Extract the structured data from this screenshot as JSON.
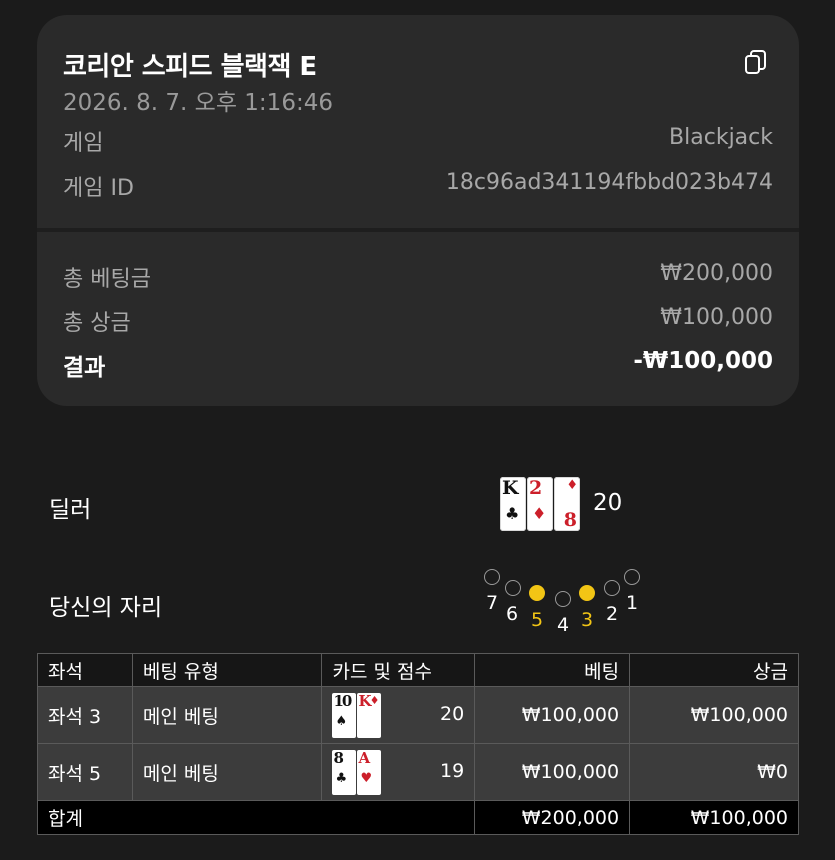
{
  "summary": {
    "title": "코리안 스피드 블랙잭 E",
    "datetime": "2026. 8. 7. 오후 1:16:46",
    "game_label": "게임",
    "game_value": "Blackjack",
    "game_id_label": "게임 ID",
    "game_id_value": "18c96ad341194fbbd023b474",
    "total_bet_label": "총 베팅금",
    "total_bet_value": "₩200,000",
    "total_win_label": "총 상금",
    "total_win_value": "₩100,000",
    "result_label": "결과",
    "result_value": "-₩100,000"
  },
  "dealer": {
    "label": "딜러",
    "score": "20",
    "cards": [
      {
        "rank": "K",
        "suit": "♣",
        "color": "black"
      },
      {
        "rank": "2",
        "suit": "♦",
        "color": "red"
      },
      {
        "rank": "8",
        "suit": "♦",
        "color": "red"
      }
    ]
  },
  "seats": {
    "label": "당신의 자리",
    "numbers": [
      "7",
      "6",
      "5",
      "4",
      "3",
      "2",
      "1"
    ],
    "active": [
      "5",
      "3"
    ]
  },
  "table": {
    "headers": [
      "좌석",
      "베팅 유형",
      "카드 및 점수",
      "베팅",
      "상금"
    ],
    "rows": [
      {
        "seat": "좌석 3",
        "type": "메인 베팅",
        "score": "20",
        "bet": "₩100,000",
        "win": "₩100,000",
        "cards": [
          {
            "rank": "10",
            "suit": "♠",
            "color": "black"
          },
          {
            "rank": "K",
            "suit": "♦",
            "color": "red"
          }
        ]
      },
      {
        "seat": "좌석 5",
        "type": "메인 베팅",
        "score": "19",
        "bet": "₩100,000",
        "win": "₩0",
        "cards": [
          {
            "rank": "8",
            "suit": "♣",
            "color": "black"
          },
          {
            "rank": "A",
            "suit": "♥",
            "color": "red"
          }
        ]
      }
    ],
    "total_label": "합계",
    "total_bet": "₩200,000",
    "total_win": "₩100,000"
  },
  "icons": {
    "copy": "copy-icon"
  },
  "colors": {
    "accent_active_seat": "#f2c515",
    "card_red": "#cc1f2a"
  }
}
